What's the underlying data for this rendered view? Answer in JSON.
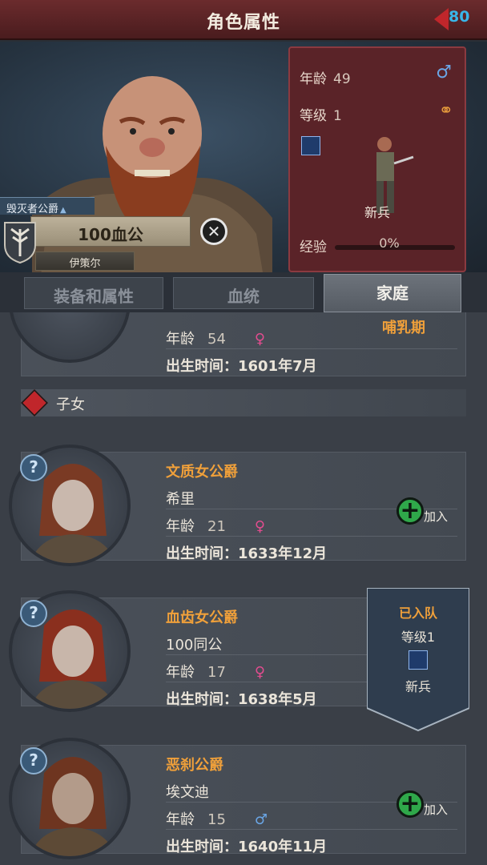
{
  "header": {
    "title": "角色属性",
    "back_count": "80"
  },
  "character": {
    "title_label": "毁灭者公爵",
    "name": "100血公",
    "sub_name": "伊策尔",
    "stats": {
      "age_label": "年龄",
      "age": "49",
      "level_label": "等级",
      "level": "1",
      "rank": "新兵",
      "xp_label": "经验",
      "xp_percent": "0%",
      "xp_fraction": 0
    }
  },
  "tabs": [
    {
      "label": "装备和属性"
    },
    {
      "label": "血统"
    },
    {
      "label": "家庭"
    }
  ],
  "active_tab": 2,
  "spouse": {
    "partial_label": "哺乳期",
    "age_label": "年龄",
    "age": "54",
    "birth_label": "出生时间：",
    "birth": "1601年7月"
  },
  "children_section": {
    "label": "子女"
  },
  "children": [
    {
      "role": "文质女公爵",
      "name": "希里",
      "age_label": "年龄",
      "age": "21",
      "gender": "female",
      "birth_label": "出生时间：",
      "birth": "1633年12月",
      "join_label": "加入"
    },
    {
      "role": "血齿女公爵",
      "name": "100同公",
      "age_label": "年龄",
      "age": "17",
      "gender": "female",
      "birth_label": "出生时间：",
      "birth": "1638年5月"
    },
    {
      "role": "恶刹公爵",
      "name": "埃文迪",
      "age_label": "年龄",
      "age": "15",
      "gender": "male",
      "birth_label": "出生时间：",
      "birth": "1640年11月",
      "join_label": "加入"
    }
  ],
  "joined_banner": {
    "status": "已入队",
    "level_label": "等级",
    "level": "1",
    "rank": "新兵"
  },
  "colors": {
    "title_bar": "#5a2326",
    "stat_panel": "#5a2328",
    "accent_orange": "#f0a03a",
    "female": "#e24c8f",
    "male": "#6aa6e6",
    "join_green": "#2fa84a"
  }
}
